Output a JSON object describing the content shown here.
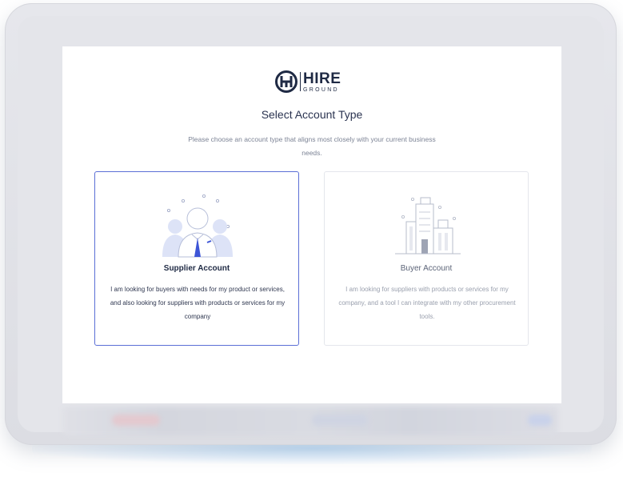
{
  "brand": {
    "name": "HIRE",
    "tagline": "GROUND"
  },
  "page": {
    "title": "Select Account Type",
    "subtitle": "Please choose an account type that aligns most closely with your current business needs."
  },
  "accounts": [
    {
      "title": "Supplier Account",
      "description": "I am looking for buyers with needs for my product or services, and also looking for suppliers with products or services for my company",
      "icon": "people-group-icon",
      "selected": true
    },
    {
      "title": "Buyer Account",
      "description": "I am looking for suppliers with products or services for my company, and a tool I can integrate with my other procurement tools.",
      "icon": "buildings-icon",
      "selected": false
    }
  ],
  "colors": {
    "brand_navy": "#1f2a44",
    "selected_border": "#5b6fd6",
    "accent_blue": "#3d55d6",
    "illustration_fill": "#dde3f7"
  }
}
